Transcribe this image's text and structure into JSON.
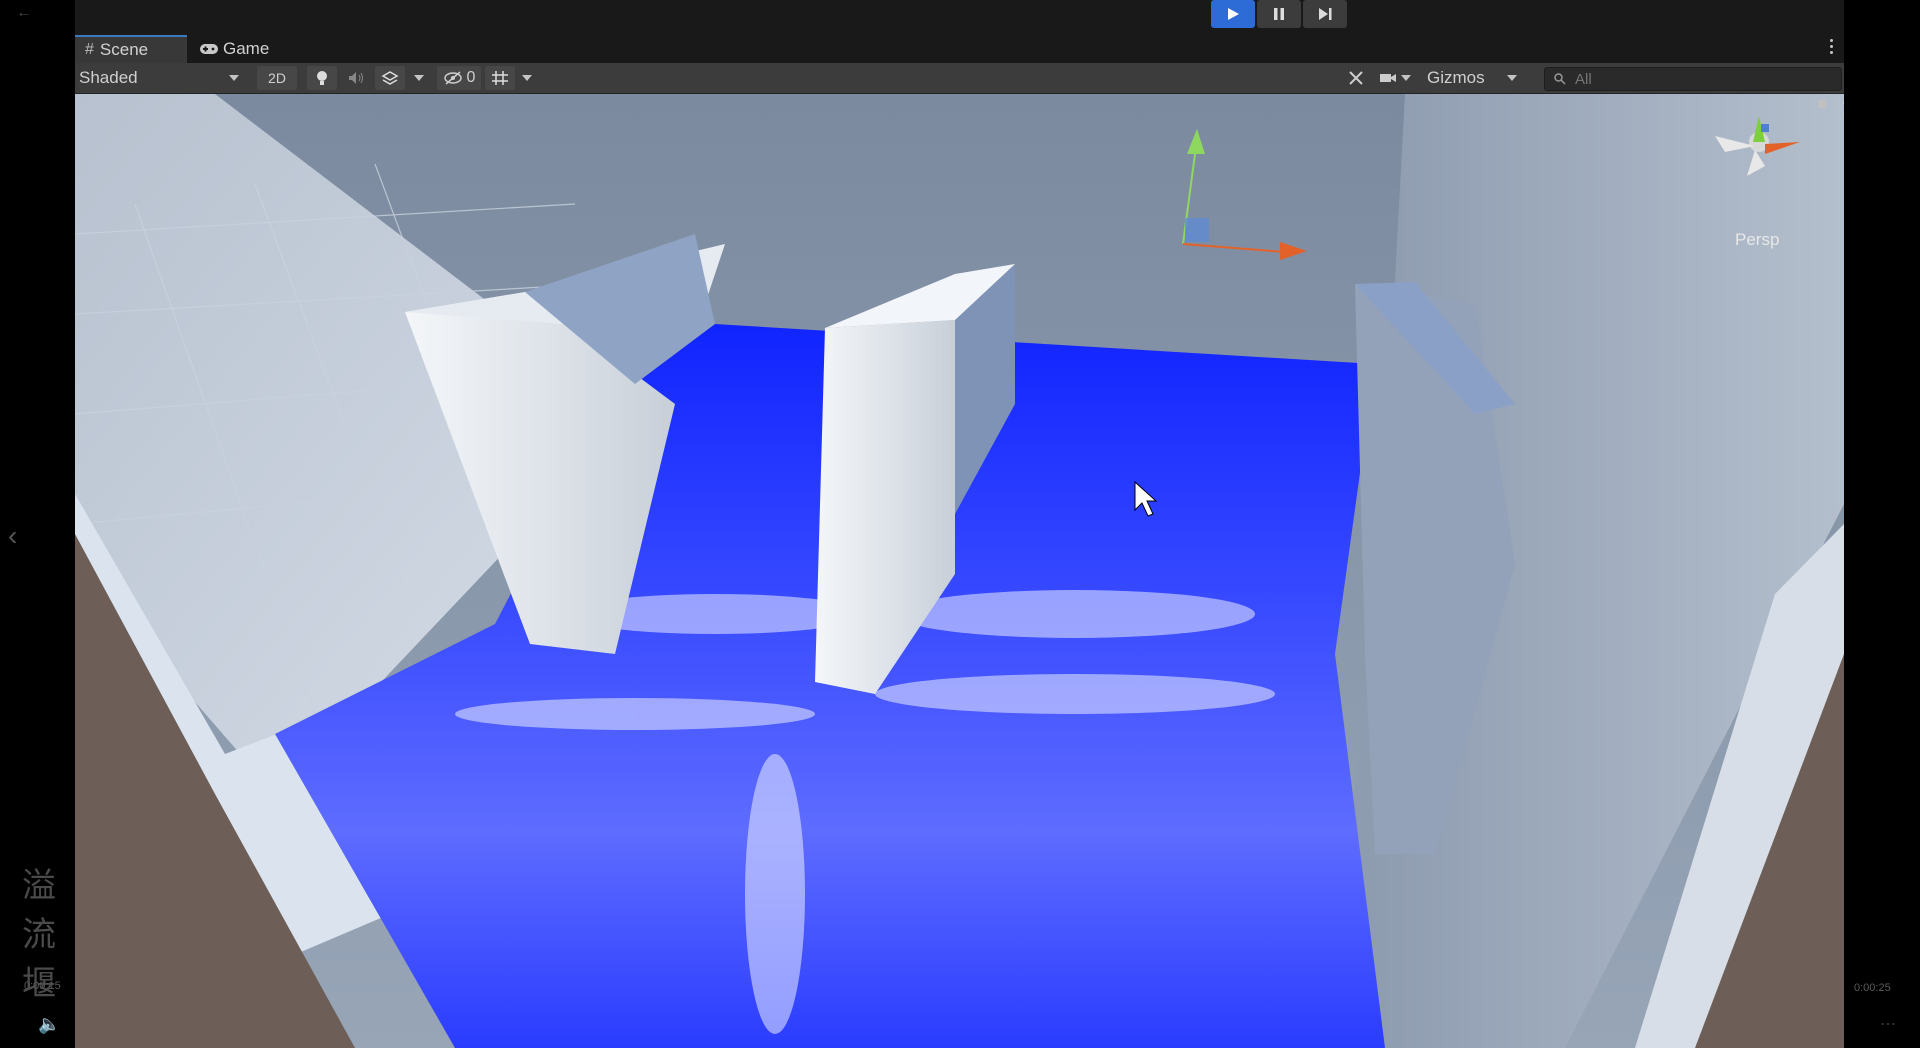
{
  "playbar": {
    "play": "play",
    "pause": "pause",
    "step": "step"
  },
  "tabs": [
    {
      "label": "Scene",
      "icon": "hash-icon",
      "active": true
    },
    {
      "label": "Game",
      "icon": "gamepad-icon",
      "active": false
    }
  ],
  "toolbar": {
    "shading_mode": "Shaded",
    "mode_2d": "2D",
    "hidden_count": "0",
    "gizmos_label": "Gizmos",
    "search_placeholder": "All"
  },
  "orientation_gizmo": {
    "y": "y",
    "z": "z",
    "x": "x",
    "projection": "Persp"
  },
  "video_overlay": {
    "title": "溢流堰",
    "time_current": "0:00:15",
    "time_total": "0:00:25"
  },
  "colors": {
    "water": "#1a2dff",
    "accent": "#2d6bd6",
    "toolbar": "#3c3c3c",
    "ground": "#6d5f57"
  }
}
